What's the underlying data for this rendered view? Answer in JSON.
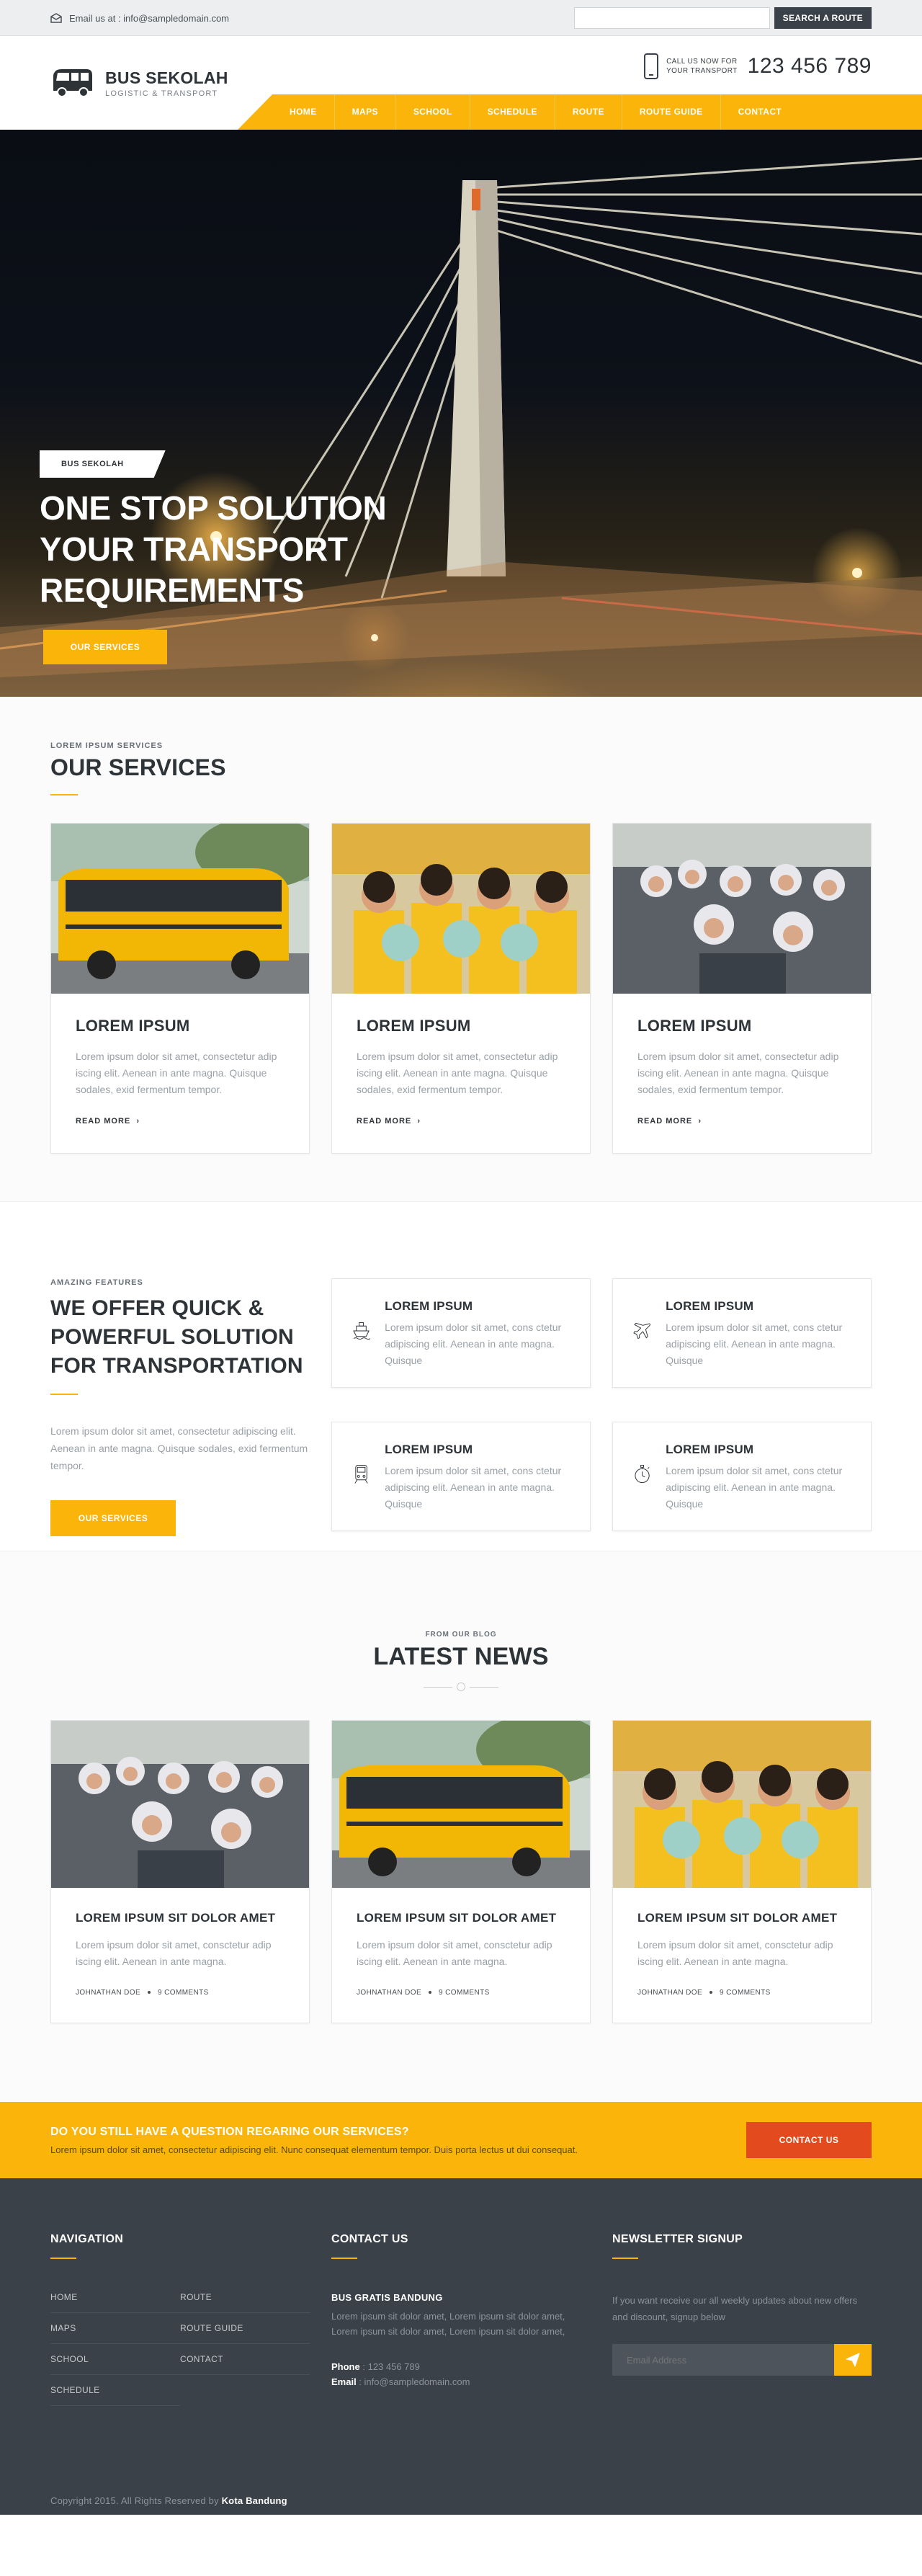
{
  "topbar": {
    "email_label": "Email us at : info@sampledomain.com",
    "search_placeholder": "",
    "search_button": "SEARCH A ROUTE"
  },
  "header": {
    "logo_title": "BUS SEKOLAH",
    "logo_tagline": "LOGISTIC & TRANSPORT",
    "call_line1": "CALL US NOW FOR",
    "call_line2": "YOUR TRANSPORT",
    "phone": "123 456 789"
  },
  "nav": {
    "items": [
      "HOME",
      "MAPS",
      "SCHOOL",
      "SCHEDULE",
      "ROUTE",
      "ROUTE GUIDE",
      "CONTACT"
    ]
  },
  "hero": {
    "badge": "BUS SEKOLAH",
    "headline_1": "ONE STOP SOLUTION",
    "headline_2": "YOUR TRANSPORT",
    "headline_3": "REQUIREMENTS",
    "button": "OUR SERVICES"
  },
  "services": {
    "eyebrow": "LOREM IPSUM SERVICES",
    "title": "OUR SERVICES",
    "cards": [
      {
        "title": "LOREM IPSUM",
        "text": "Lorem ipsum dolor sit amet, consectetur adip iscing elit. Aenean in ante magna. Quisque sodales, exid fermentum tempor.",
        "more": "READ MORE"
      },
      {
        "title": "LOREM IPSUM",
        "text": "Lorem ipsum dolor sit amet, consectetur adip iscing elit. Aenean in ante magna. Quisque sodales, exid fermentum tempor.",
        "more": "READ MORE"
      },
      {
        "title": "LOREM IPSUM",
        "text": "Lorem ipsum dolor sit amet, consectetur adip iscing elit. Aenean in ante magna. Quisque sodales, exid fermentum tempor.",
        "more": "READ MORE"
      }
    ]
  },
  "features": {
    "eyebrow": "AMAZING FEATURES",
    "title_1": "WE OFFER QUICK &",
    "title_2": "POWERFUL SOLUTION",
    "title_3": "FOR TRANSPORTATION",
    "text": "Lorem ipsum dolor sit amet, consectetur adipiscing elit. Aenean in ante magna. Quisque sodales, exid fermentum tempor.",
    "button": "OUR SERVICES",
    "boxes": [
      {
        "icon": "ship-icon",
        "title": "LOREM IPSUM",
        "text": "Lorem ipsum dolor sit amet, cons ctetur adipiscing elit. Aenean in ante magna. Quisque"
      },
      {
        "icon": "airplane-icon",
        "title": "LOREM IPSUM",
        "text": "Lorem ipsum dolor sit amet, cons ctetur adipiscing elit. Aenean in ante magna. Quisque"
      },
      {
        "icon": "train-icon",
        "title": "LOREM IPSUM",
        "text": "Lorem ipsum dolor sit amet, cons ctetur adipiscing elit. Aenean in ante magna. Quisque"
      },
      {
        "icon": "stopwatch-icon",
        "title": "LOREM IPSUM",
        "text": "Lorem ipsum dolor sit amet, cons ctetur adipiscing elit. Aenean in ante magna. Quisque"
      }
    ]
  },
  "news": {
    "eyebrow": "FROM OUR BLOG",
    "title": "LATEST NEWS",
    "cards": [
      {
        "title": "LOREM IPSUM SIT DOLOR AMET",
        "text": "Lorem ipsum dolor sit amet, consctetur adip iscing elit. Aenean in ante magna.",
        "author": "JOHNATHAN DOE",
        "comments": "9 COMMENTS"
      },
      {
        "title": "LOREM IPSUM SIT DOLOR AMET",
        "text": "Lorem ipsum dolor sit amet, consctetur adip iscing elit. Aenean in ante magna.",
        "author": "JOHNATHAN DOE",
        "comments": "9 COMMENTS"
      },
      {
        "title": "LOREM IPSUM SIT DOLOR AMET",
        "text": "Lorem ipsum dolor sit amet, consctetur adip iscing elit. Aenean in ante magna.",
        "author": "JOHNATHAN DOE",
        "comments": "9 COMMENTS"
      }
    ]
  },
  "cta": {
    "title": "DO YOU STILL HAVE A QUESTION REGARING OUR SERVICES?",
    "text": "Lorem ipsum dolor sit amet, consectetur adipiscing elit. Nunc consequat elementum tempor. Duis porta lectus ut dui consequat.",
    "button": "CONTACT US"
  },
  "footer": {
    "nav_title": "NAVIGATION",
    "nav_links": [
      "HOME",
      "ROUTE",
      "MAPS",
      "ROUTE GUIDE",
      "SCHOOL",
      "CONTACT",
      "SCHEDULE"
    ],
    "contact_title": "CONTACT US",
    "contact_name": "BUS GRATIS BANDUNG",
    "contact_desc": "Lorem ipsum sit dolor amet, Lorem ipsum sit dolor amet, Lorem ipsum sit dolor amet, Lorem ipsum sit dolor amet,",
    "phone_label": "Phone",
    "phone_value": ": 123 456 789",
    "email_label": "Email",
    "email_value": ": info@sampledomain.com",
    "newsletter_title": "NEWSLETTER SIGNUP",
    "newsletter_desc": "If you want receive our all weekly updates about new offers and discount, signup below",
    "newsletter_placeholder": "Email Address",
    "copyright": "Copyright 2015. All Rights Reserved by",
    "copyright_brand": "Kota Bandung"
  },
  "colors": {
    "accent": "#fbb40a",
    "dark": "#3b4148",
    "cta_button": "#e34a1d"
  }
}
